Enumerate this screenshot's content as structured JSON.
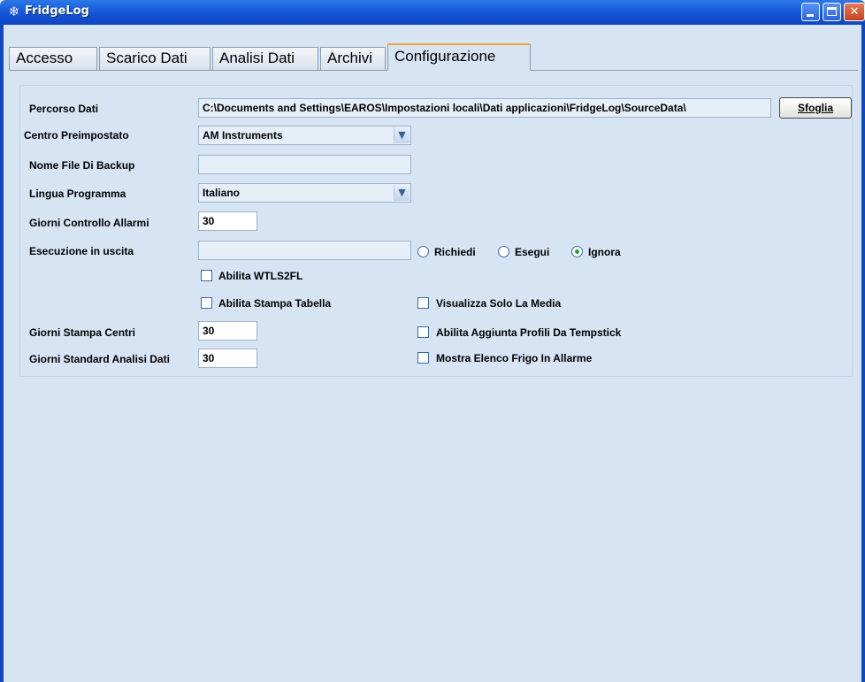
{
  "window": {
    "title": "FridgeLog",
    "app_icon": "snowflake-icon"
  },
  "tabs": [
    {
      "label": "Accesso",
      "active": false
    },
    {
      "label": "Scarico Dati",
      "active": false
    },
    {
      "label": "Analisi Dati",
      "active": false
    },
    {
      "label": "Archivi",
      "active": false
    },
    {
      "label": "Configurazione",
      "active": true
    }
  ],
  "form": {
    "percorso_dati": {
      "label": "Percorso Dati",
      "value": "C:\\Documents and Settings\\EAROS\\Impostazioni locali\\Dati applicazioni\\FridgeLog\\SourceData\\",
      "browse_label": "Sfoglia"
    },
    "centro": {
      "label": "Centro Preimpostato",
      "value": "AM Instruments"
    },
    "backup": {
      "label": "Nome File Di Backup",
      "value": ""
    },
    "lingua": {
      "label": "Lingua Programma",
      "value": "Italiano"
    },
    "giorni_allarmi": {
      "label": "Giorni Controllo Allarmi",
      "value": "30"
    },
    "esecuzione": {
      "label": "Esecuzione in uscita",
      "value": "",
      "options": [
        "Richiedi",
        "Esegui",
        "Ignora"
      ],
      "selected": "Ignora"
    },
    "abilita_wtls2fl": {
      "label": "Abilita WTLS2FL",
      "checked": false
    },
    "abilita_stampa": {
      "label": "Abilita Stampa Tabella",
      "checked": false
    },
    "visualizza_media": {
      "label": "Visualizza Solo La Media",
      "checked": false
    },
    "giorni_stampa": {
      "label": "Giorni Stampa Centri",
      "value": "30"
    },
    "abilita_tempstick": {
      "label": "Abilita Aggiunta Profili Da Tempstick",
      "checked": false
    },
    "giorni_analisi": {
      "label": "Giorni Standard Analisi Dati",
      "value": "30"
    },
    "mostra_frigo": {
      "label": "Mostra Elenco Frigo In Allarme",
      "checked": false
    }
  },
  "colors": {
    "titlebar": "#1353d6",
    "background": "#d6e4f3",
    "active_tab_accent": "#f2a33a",
    "radio_dot": "#21a121"
  }
}
